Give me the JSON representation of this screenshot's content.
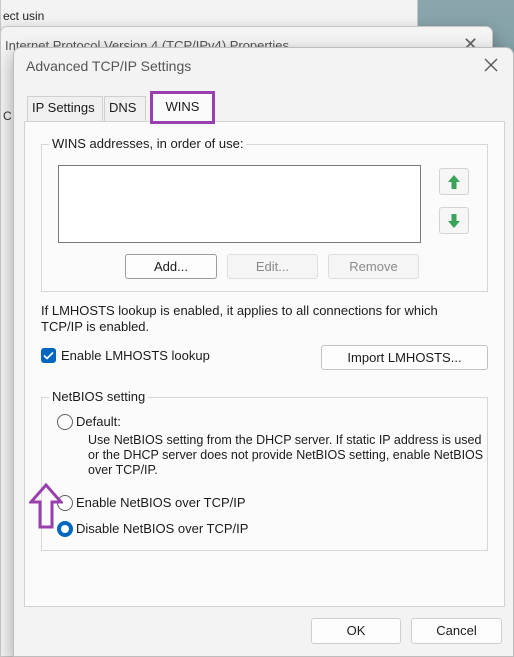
{
  "background": {
    "far_window_partial_text": "ect usin",
    "mid_window_title": "Internet Protocol Version 4 (TCP/IPv4) Properties",
    "mid_window_left_char": "C"
  },
  "dialog": {
    "title": "Advanced TCP/IP Settings"
  },
  "tabs": [
    {
      "label": "IP Settings",
      "selected": false
    },
    {
      "label": "DNS",
      "selected": false
    },
    {
      "label": "WINS",
      "selected": true
    }
  ],
  "wins": {
    "group_label": "WINS addresses, in order of use:",
    "addresses": [],
    "add_label": "Add...",
    "edit_label": "Edit...",
    "remove_label": "Remove"
  },
  "lmhosts": {
    "info": "If LMHOSTS lookup is enabled, it applies to all connections for which TCP/IP is enabled.",
    "enable_label": "Enable LMHOSTS lookup",
    "enabled": true,
    "import_label": "Import LMHOSTS..."
  },
  "netbios": {
    "group_label": "NetBIOS setting",
    "default_label": "Default:",
    "default_desc": "Use NetBIOS setting from the DHCP server. If static IP address is used or the DHCP server does not provide NetBIOS setting, enable NetBIOS over TCP/IP.",
    "enable_label": "Enable NetBIOS over TCP/IP",
    "disable_label": "Disable NetBIOS over TCP/IP",
    "selected": "disable"
  },
  "footer": {
    "ok_label": "OK",
    "cancel_label": "Cancel"
  },
  "colors": {
    "accent": "#0067c0",
    "highlight": "#9a3fb0",
    "arrow_green": "#3aa35a"
  },
  "icons": {
    "close": "close-icon",
    "move_up": "arrow-up-icon",
    "move_down": "arrow-down-icon",
    "checkmark": "checkmark-icon",
    "annotation": "annotation-arrow-icon"
  }
}
